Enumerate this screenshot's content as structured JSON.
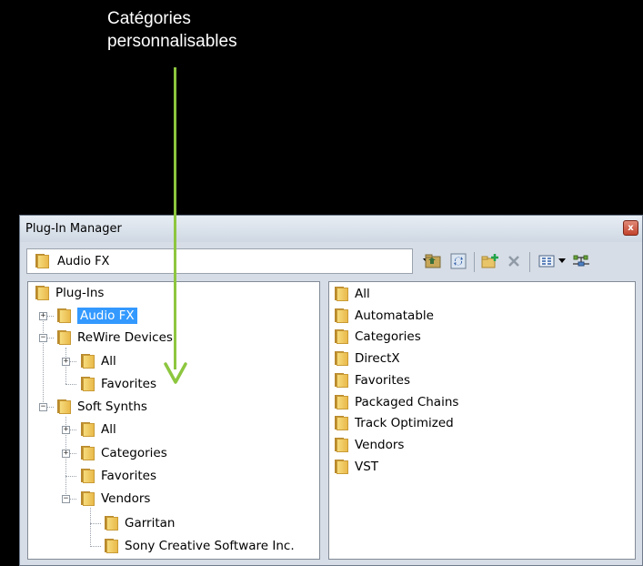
{
  "annotation": {
    "line1": "Catégories",
    "line2": "personnalisables"
  },
  "colors": {
    "arrow": "#8dc63f",
    "selection": "#3399ff"
  },
  "window": {
    "title": "Plug-In Manager",
    "close_glyph": "x"
  },
  "toolbar": {
    "combo_value": "Audio FX",
    "buttons": [
      "folder-up-icon",
      "refresh-icon",
      "new-folder-icon",
      "delete-icon",
      "view-icon",
      "view-dropdown-icon",
      "plug-in-properties-icon"
    ]
  },
  "tree": {
    "root": "Plug-Ins",
    "audio_fx": "Audio FX",
    "rewire": "ReWire Devices",
    "rewire_all": "All",
    "rewire_favorites": "Favorites",
    "soft_synths": "Soft Synths",
    "ss_all": "All",
    "ss_categories": "Categories",
    "ss_favorites": "Favorites",
    "ss_vendors": "Vendors",
    "vendor_garritan": "Garritan",
    "vendor_sony": "Sony Creative Software Inc.",
    "selected": "Audio FX"
  },
  "list": {
    "items": [
      "All",
      "Automatable",
      "Categories",
      "DirectX",
      "Favorites",
      "Packaged Chains",
      "Track Optimized",
      "Vendors",
      "VST"
    ]
  }
}
